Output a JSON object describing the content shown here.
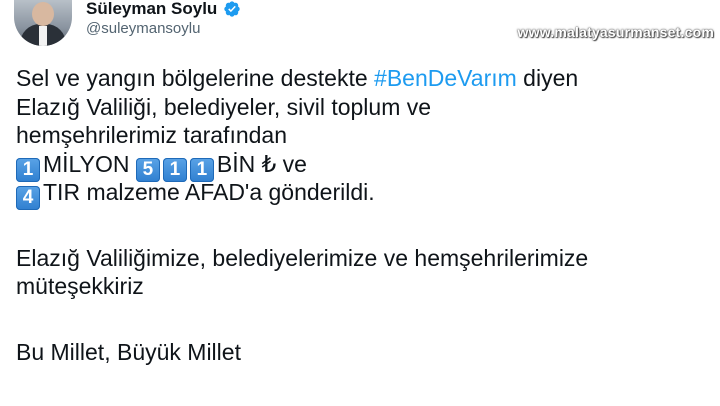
{
  "header": {
    "display_name": "Süleyman Soylu",
    "handle": "@suleymansoylu"
  },
  "watermark": "www.malatyasurmanset.com",
  "tweet": {
    "l1_prefix": "Sel ve yangın bölgelerine destekte ",
    "hashtag": "#BenDeVarım",
    "l1_suffix": " diyen",
    "l2": "Elazığ Valiliği, belediyeler, sivil toplum ve",
    "l3": "hemşehrilerimiz tarafından",
    "l4_k1": "1",
    "l4_t1": "MİLYON ",
    "l4_k2": "5",
    "l4_k3": "1",
    "l4_k4": "1",
    "l4_t2": "BİN ₺ ve",
    "l5_k1": "4",
    "l5_t1": "TIR malzeme AFAD'a gönderildi.",
    "l6": "Elazığ Valiliğimize, belediyelerimize ve hemşehrilerimize",
    "l7": "müteşekkiriz",
    "l8": "Bu Millet, Büyük Millet"
  },
  "icons": {
    "verified": "verified-badge-icon",
    "verified_color": "#1d9bf0",
    "keycap_color": "#3b8ad9"
  }
}
